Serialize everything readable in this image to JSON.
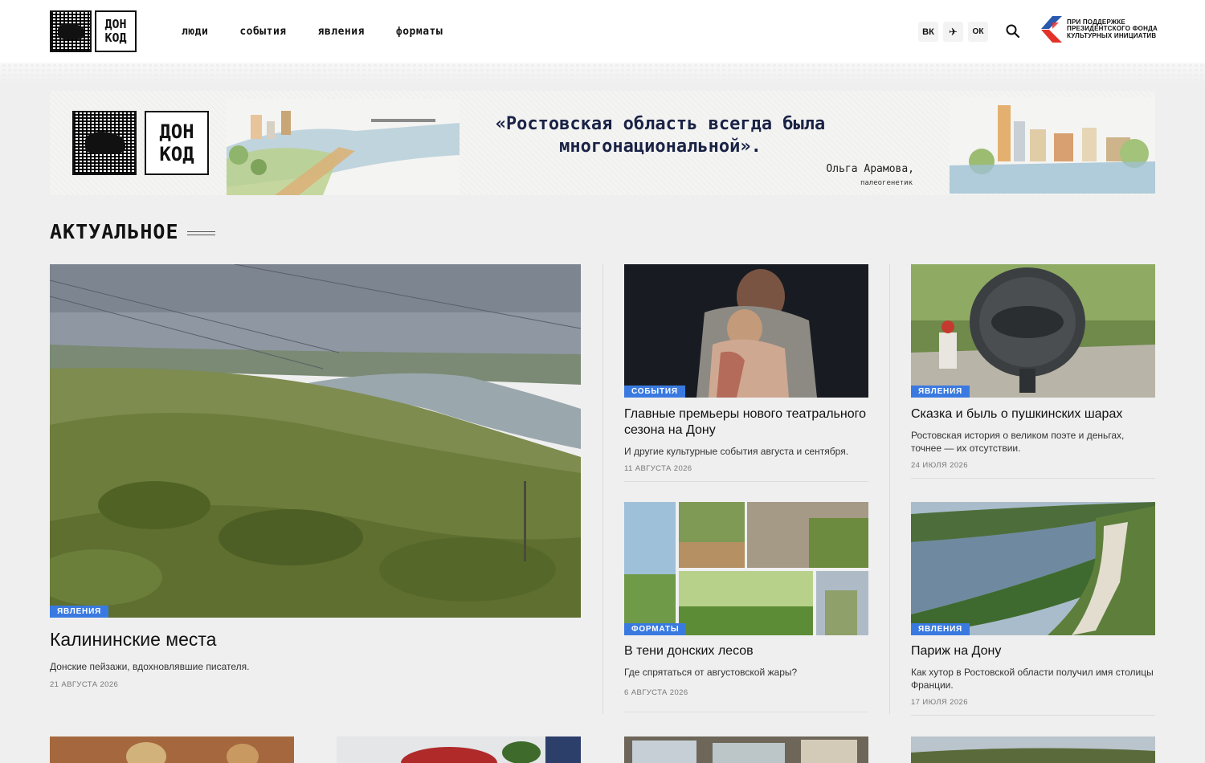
{
  "header": {
    "logo_line1": "ДОН",
    "logo_line2": "КОД",
    "nav": [
      "люди",
      "события",
      "явления",
      "форматы"
    ],
    "socials": [
      "ВК",
      "✈",
      "ОК"
    ],
    "sponsor": "ПРИ ПОДДЕРЖКЕ ПРЕЗИДЕНТСКОГО ФОНДА КУЛЬТУРНЫХ ИНИЦИАТИВ",
    "sponsor_colors": [
      "#e4322b",
      "#2a5ab0"
    ]
  },
  "banner": {
    "logo_line1": "ДОН",
    "logo_line2": "КОД",
    "quote": "«Ростовская область всегда была многонациональной».",
    "author": "Ольга Арамова,",
    "role": "палеогенетик"
  },
  "section": {
    "title": "АКТУАЛЬНОЕ"
  },
  "articles": [
    {
      "tag": "ЯВЛЕНИЯ",
      "title": "Калининские места",
      "desc": "Донские пейзажи, вдохновлявшие писателя.",
      "date": "21 АВГУСТА 2026"
    },
    {
      "tag": "СОБЫТИЯ",
      "title": "Главные премьеры нового театрального сезона на Дону",
      "desc": "И другие культурные события августа и сентября.",
      "date": "11 АВГУСТА 2026"
    },
    {
      "tag": "ЯВЛЕНИЯ",
      "title": "Сказка и быль о пушкинских шарах",
      "desc": "Ростовская история о великом поэте и деньгах, точнее — их отсутствии.",
      "date": "24 ИЮЛЯ 2026"
    },
    {
      "tag": "ФОРМАТЫ",
      "title": "В тени донских лесов",
      "desc": "Где спрятаться от августовской жары?",
      "date": "6 АВГУСТА 2026"
    },
    {
      "tag": "ЯВЛЕНИЯ",
      "title": "Париж на Дону",
      "desc": "Как хутор в Ростовской области получил имя столицы Франции.",
      "date": "17 ИЮЛЯ 2026"
    }
  ],
  "accent": "#3a7ae0"
}
